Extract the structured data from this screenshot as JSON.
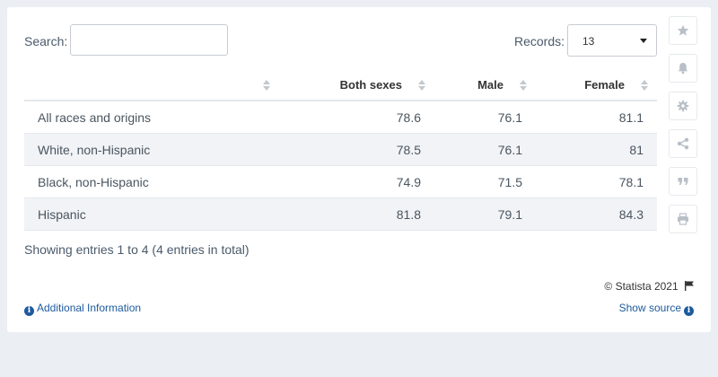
{
  "search": {
    "label": "Search:",
    "value": "",
    "placeholder": ""
  },
  "records": {
    "label": "Records:",
    "selected": "13"
  },
  "table": {
    "headers": [
      "",
      "Both sexes",
      "Male",
      "Female"
    ],
    "rows": [
      {
        "label": "All races and origins",
        "both": "78.6",
        "male": "76.1",
        "female": "81.1"
      },
      {
        "label": "White, non-Hispanic",
        "both": "78.5",
        "male": "76.1",
        "female": "81"
      },
      {
        "label": "Black, non-Hispanic",
        "both": "74.9",
        "male": "71.5",
        "female": "78.1"
      },
      {
        "label": "Hispanic",
        "both": "81.8",
        "male": "79.1",
        "female": "84.3"
      }
    ]
  },
  "footer": {
    "showing": "Showing entries 1 to 4 (4 entries in total)",
    "copyright": "© Statista 2021",
    "additional_info": "Additional Information",
    "show_source": "Show source"
  },
  "tools": [
    "star-icon",
    "bell-icon",
    "gear-icon",
    "share-icon",
    "quote-icon",
    "print-icon"
  ],
  "colors": {
    "link": "#1d5a9e",
    "stripe": "#f1f3f6",
    "page_bg": "#ebeef3"
  }
}
